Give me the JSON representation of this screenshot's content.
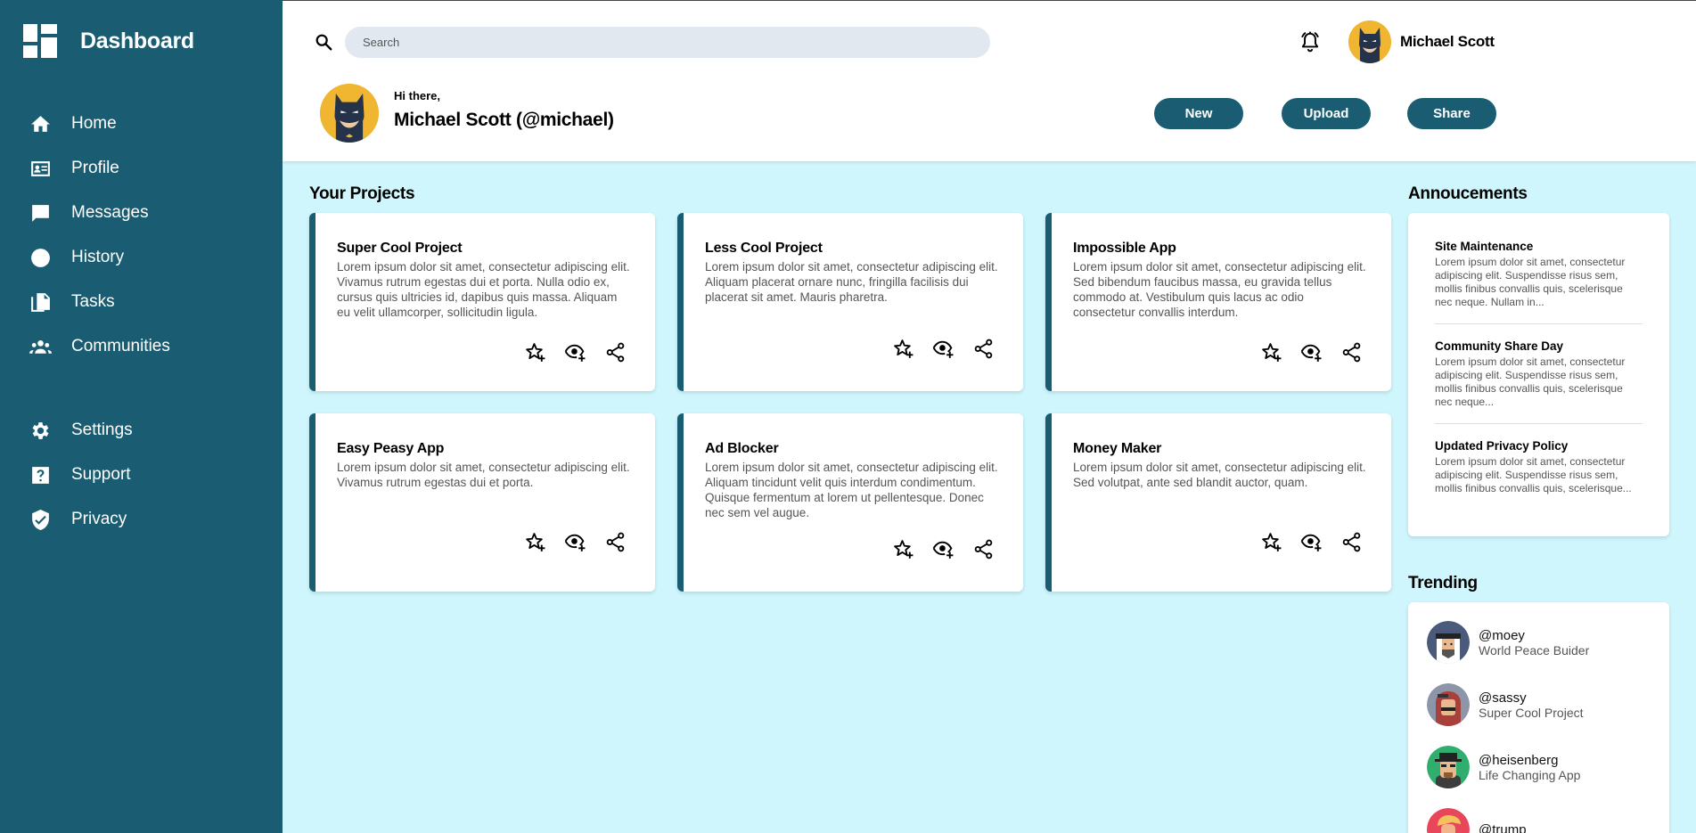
{
  "brand": {
    "title": "Dashboard"
  },
  "nav": {
    "items": [
      {
        "label": "Home",
        "icon": "home-icon"
      },
      {
        "label": "Profile",
        "icon": "id-card-icon"
      },
      {
        "label": "Messages",
        "icon": "chat-icon"
      },
      {
        "label": "History",
        "icon": "clock-icon"
      },
      {
        "label": "Tasks",
        "icon": "document-icon"
      },
      {
        "label": "Communities",
        "icon": "group-icon"
      }
    ],
    "secondary": [
      {
        "label": "Settings",
        "icon": "gear-icon"
      },
      {
        "label": "Support",
        "icon": "help-icon"
      },
      {
        "label": "Privacy",
        "icon": "shield-icon"
      }
    ]
  },
  "header": {
    "search_placeholder": "Search",
    "user_name": "Michael Scott",
    "greeting": "Hi there,",
    "full_name": "Michael Scott (@michael)",
    "buttons": {
      "new": "New",
      "upload": "Upload",
      "share": "Share"
    }
  },
  "projects": {
    "title": "Your Projects",
    "cards": [
      {
        "title": "Super Cool Project",
        "desc": "Lorem ipsum dolor sit amet, consectetur adipiscing elit. Vivamus rutrum egestas dui et porta. Nulla odio ex, cursus quis ultricies id, dapibus quis massa. Aliquam eu velit ullamcorper, sollicitudin ligula."
      },
      {
        "title": "Less Cool Project",
        "desc": "Lorem ipsum dolor sit amet, consectetur adipiscing elit. Aliquam placerat ornare nunc, fringilla facilisis dui placerat sit amet. Mauris pharetra."
      },
      {
        "title": "Impossible App",
        "desc": "Lorem ipsum dolor sit amet, consectetur adipiscing elit. Sed bibendum faucibus massa, eu gravida tellus commodo at. Vestibulum quis lacus ac odio consectetur convallis interdum."
      },
      {
        "title": "Easy Peasy App",
        "desc": "Lorem ipsum dolor sit amet, consectetur adipiscing elit. Vivamus rutrum egestas dui et porta."
      },
      {
        "title": "Ad Blocker",
        "desc": "Lorem ipsum dolor sit amet, consectetur adipiscing elit. Aliquam tincidunt velit quis interdum condimentum. Quisque fermentum at lorem ut pellentesque. Donec nec sem vel augue."
      },
      {
        "title": "Money Maker",
        "desc": "Lorem ipsum dolor sit amet, consectetur adipiscing elit. Sed volutpat, ante sed blandit auctor, quam."
      }
    ]
  },
  "announcements": {
    "title": "Annoucements",
    "items": [
      {
        "title": "Site Maintenance",
        "body": "Lorem ipsum dolor sit amet, consectetur adipiscing elit. Suspendisse risus sem, mollis finibus convallis quis, scelerisque nec neque. Nullam in..."
      },
      {
        "title": "Community Share Day",
        "body": "Lorem ipsum dolor sit amet, consectetur adipiscing elit. Suspendisse risus sem, mollis finibus convallis quis, scelerisque nec neque..."
      },
      {
        "title": "Updated Privacy Policy",
        "body": "Lorem ipsum dolor sit amet, consectetur adipiscing elit. Suspendisse risus sem, mollis finibus convallis quis, scelerisque..."
      }
    ]
  },
  "trending": {
    "title": "Trending",
    "items": [
      {
        "handle": "@moey",
        "sub": "World Peace Buider"
      },
      {
        "handle": "@sassy",
        "sub": "Super Cool Project"
      },
      {
        "handle": "@heisenberg",
        "sub": "Life Changing App"
      },
      {
        "handle": "@trump",
        "sub": ""
      }
    ]
  },
  "colors": {
    "primary": "#1a5d72",
    "background": "#cef6fc",
    "avatar_yellow": "#f0b531"
  }
}
